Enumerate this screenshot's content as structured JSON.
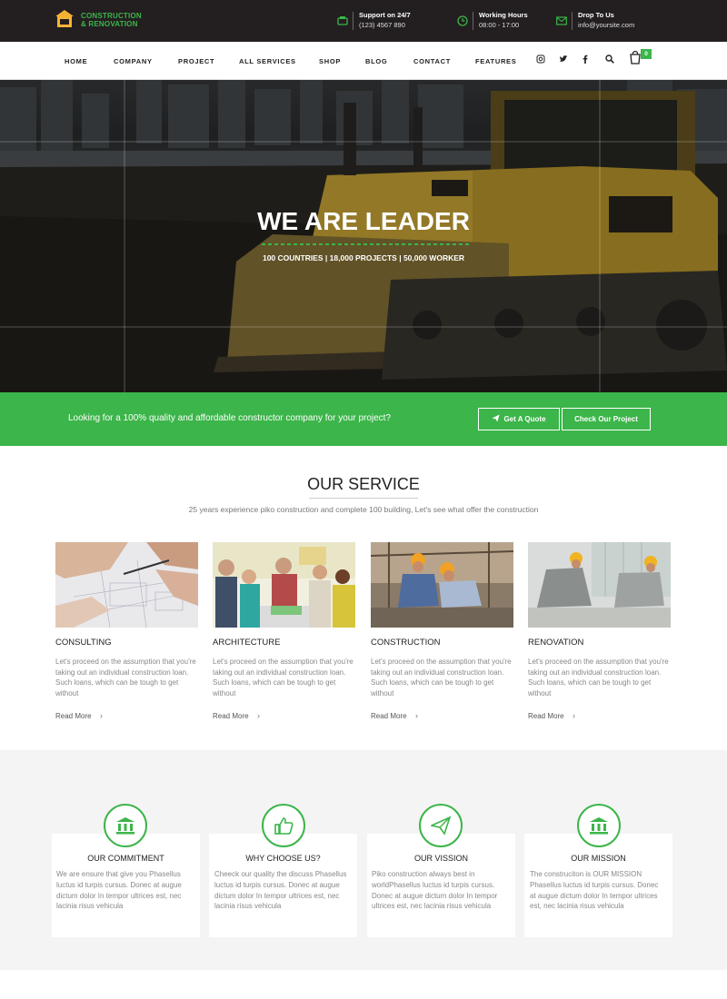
{
  "brand": {
    "line1": "CONSTRUCTION",
    "line2": "& RENOVATION",
    "accent": "#3cb54a"
  },
  "contacts": [
    {
      "title": "Support on 24/7",
      "value": "(123) 4567 890",
      "icon": "phone-icon"
    },
    {
      "title": "Working Hours",
      "value": "08:00 - 17:00",
      "icon": "clock-icon"
    },
    {
      "title": "Drop To Us",
      "value": "info@yoursite.com",
      "icon": "mail-icon"
    }
  ],
  "nav": {
    "items": [
      "HOME",
      "COMPANY",
      "PROJECT",
      "ALL SERVICES",
      "SHOP",
      "BLOG",
      "CONTACT",
      "FEATURES"
    ],
    "cart_count": "0"
  },
  "hero": {
    "title": "WE ARE LEADER",
    "subtitle": "100 COUNTRIES | 18,000 PROJECTS | 50,000 WORKER"
  },
  "cta": {
    "text": "Looking for a 100% quality and affordable constructor company for your project?",
    "quote_label": "Get A Quote",
    "project_label": "Check Our Project"
  },
  "service": {
    "title": "OUR SERVICE",
    "subtitle": "25 years experience piko construction and complete 100 building, Let's see what offer the construction",
    "cards": [
      {
        "title": "CONSULTING",
        "text": "Let's proceed on the assumption that you're taking out an individual construction loan. Such loans, which can be tough to get without",
        "link": "Read More"
      },
      {
        "title": "ARCHITECTURE",
        "text": "Let's proceed on the assumption that you're taking out an individual construction loan. Such loans, which can be tough to get without",
        "link": "Read More"
      },
      {
        "title": "CONSTRUCTION",
        "text": "Let's proceed on the assumption that you're taking out an individual construction loan. Such loans, which can be tough to get without",
        "link": "Read More"
      },
      {
        "title": "RENOVATION",
        "text": "Let's proceed on the assumption that you're taking out an individual construction loan. Such loans, which can be tough to get without",
        "link": "Read More"
      }
    ]
  },
  "features": [
    {
      "title": "OUR COMMITMENT",
      "text": "We are ensure that give you Phasellus luctus id turpis cursus. Donec at augue dictum dolor In tempor ultrices est, nec lacinia risus vehicula",
      "icon": "bank-icon"
    },
    {
      "title": "WHY CHOOSE US?",
      "text": "Cheeck our quality the discuss Phasellus luctus id turpis cursus. Donec at augue dictum dolor In tempor ultrices est, nec lacinia risus vehicula",
      "icon": "thumbs-up-icon"
    },
    {
      "title": "OUR VISSION",
      "text": "Piko construction always best in worldPhasellus luctus id turpis cursus. Donec at augue dictum dolor In tempor ultrices est, nec lacinia risus vehicula",
      "icon": "paper-plane-icon"
    },
    {
      "title": "OUR MISSION",
      "text": "The construciton is OUR MISSION Phasellus luctus id turpis cursus. Donec at augue dictum dolor In tempor ultrices est, nec lacinia risus vehicula",
      "icon": "bank-icon"
    }
  ]
}
